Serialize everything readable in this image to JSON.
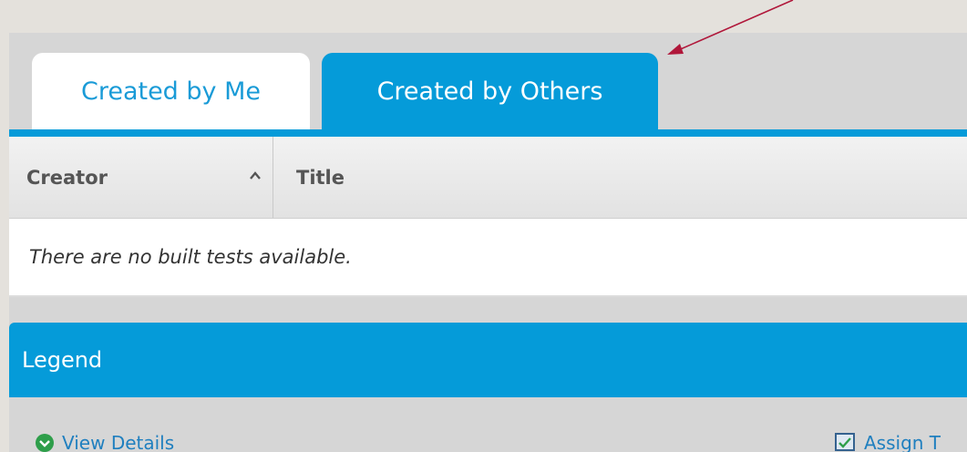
{
  "tabs": {
    "created_by_me": "Created by Me",
    "created_by_others": "Created by Others"
  },
  "table": {
    "columns": [
      "Creator",
      "Title"
    ],
    "empty_message": "There are no built tests available."
  },
  "legend": {
    "title": "Legend",
    "items": [
      "View Details",
      "Assign T"
    ]
  },
  "colors": {
    "accent": "#059bd9",
    "annotation_arrow": "#b0173a"
  },
  "icons": {
    "sort": "sort-up-icon",
    "view_details": "view-details-icon",
    "assign": "assign-test-icon"
  }
}
